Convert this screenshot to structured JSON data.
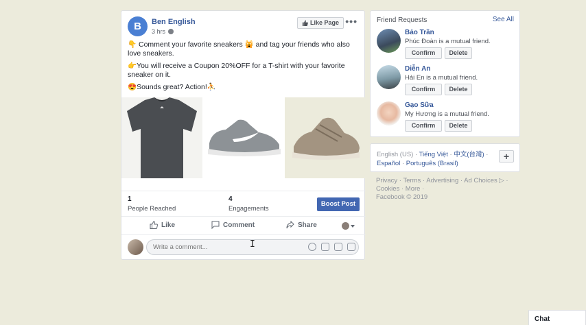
{
  "post": {
    "author": "Ben English",
    "avatar_letter": "B",
    "time": "3 hrs",
    "like_page_label": "Like Page",
    "more_label": "•••",
    "lines": [
      "👇 Comment your favorite sneakers 🙀 and tag your friends who also love sneakers.",
      "👉You will receive a Coupon 20%OFF for a T-shirt with your favorite sneaker on it.",
      "😍Sounds great? Action!⛹"
    ],
    "stats": {
      "reached_value": "1",
      "reached_label": "People Reached",
      "engagements_value": "4",
      "engagements_label": "Engagements"
    },
    "boost_label": "Boost Post",
    "actions": {
      "like": "Like",
      "comment": "Comment",
      "share": "Share"
    },
    "comment_placeholder": "Write a comment..."
  },
  "friend_requests": {
    "title": "Friend Requests",
    "see_all": "See All",
    "items": [
      {
        "name": "Bảo Trần",
        "mutual": "Phúc Đoàn is a mutual friend.",
        "confirm": "Confirm",
        "delete": "Delete"
      },
      {
        "name": "Diễn An",
        "mutual": "Hải En is a mutual friend.",
        "confirm": "Confirm",
        "delete": "Delete"
      },
      {
        "name": "Gạo Sữa",
        "mutual": "My Hương is a mutual friend.",
        "confirm": "Confirm",
        "delete": "Delete"
      }
    ]
  },
  "languages": {
    "current": "English (US)",
    "options": [
      "Tiếng Việt",
      "中文(台灣)",
      "Español",
      "Português (Brasil)"
    ],
    "add_label": "+"
  },
  "footer": {
    "links": [
      "Privacy",
      "Terms",
      "Advertising",
      "Ad Choices",
      "Cookies",
      "More"
    ],
    "copyright": "Facebook © 2019"
  },
  "chat_label": "Chat",
  "colors": {
    "fb_blue": "#4267b2",
    "link": "#365899",
    "page_bg": "#ecebdc"
  }
}
